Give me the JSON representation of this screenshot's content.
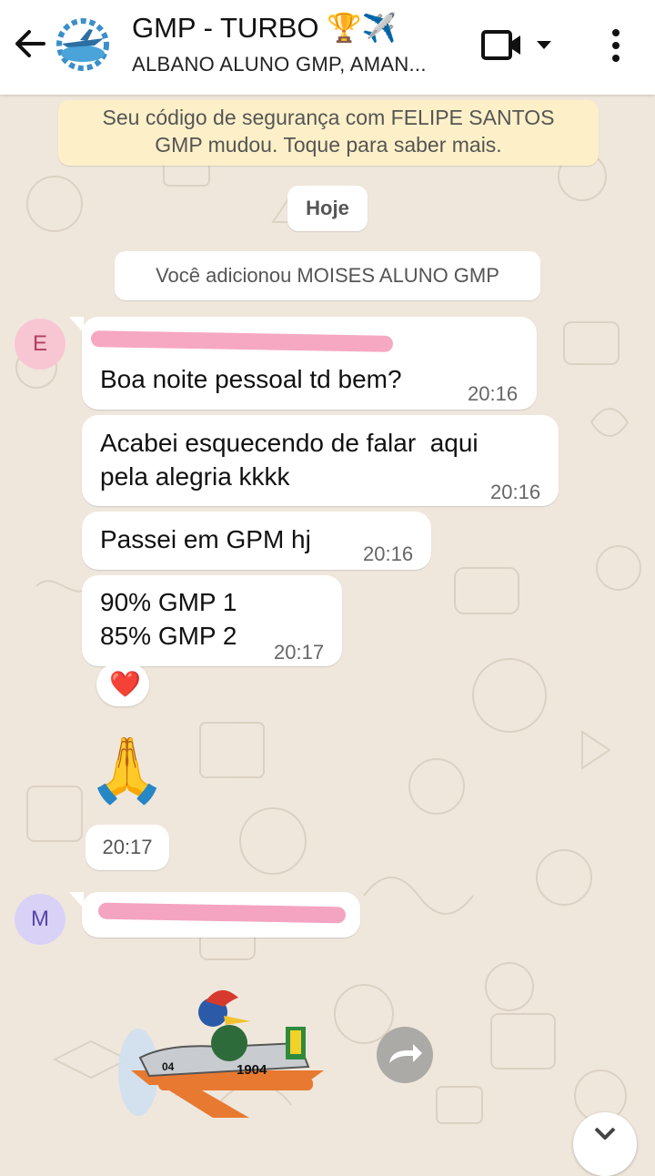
{
  "header": {
    "title": "GMP - TURBO 🏆✈️",
    "subtitle": "ALBANO ALUNO GMP, AMAN..."
  },
  "notices": {
    "security": "Seu código de segurança com FELIPE SANTOS\nGMP mudou. Toque para saber mais.",
    "date": "Hoje",
    "added": "Você adicionou MOISES ALUNO GMP"
  },
  "messages": [
    {
      "text": "Boa noite pessoal td bem?",
      "time": "20:16"
    },
    {
      "text": "Acabei esquecendo de falar  aqui\npela alegria kkkk",
      "time": "20:16"
    },
    {
      "text": "Passei em GPM hj",
      "time": "20:16"
    },
    {
      "text": "90% GMP 1\n85% GMP 2",
      "time": "20:17",
      "reaction": "❤️"
    }
  ],
  "emoji_message": {
    "emoji": "🙏",
    "time": "20:17"
  },
  "avatars": {
    "first": "E",
    "second": "M"
  },
  "sticker": {
    "plane_number": "1904",
    "tail_number": "04"
  },
  "colors": {
    "accent": "#f6a8c3",
    "security_bg": "#fdf0c8",
    "background": "#efe7dc"
  }
}
